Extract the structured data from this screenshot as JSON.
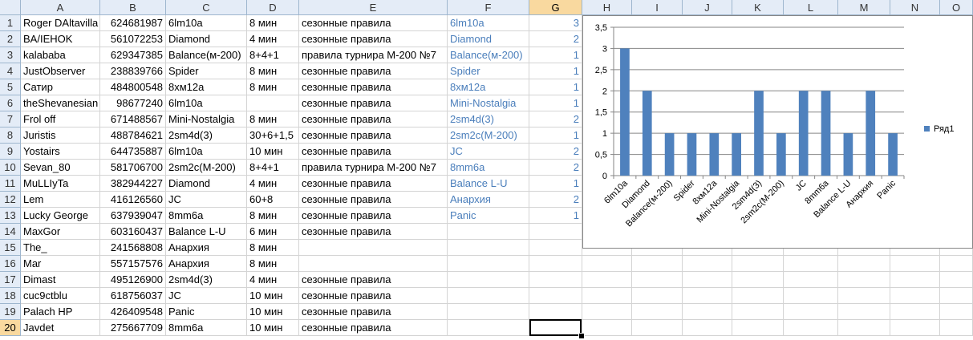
{
  "columns": [
    "A",
    "B",
    "C",
    "D",
    "E",
    "F",
    "G",
    "H",
    "I",
    "J",
    "K",
    "L",
    "M",
    "N",
    "O"
  ],
  "selected_column": "G",
  "selected_row": 20,
  "rows": [
    {
      "n": "1",
      "a": "Roger DAltavilla",
      "b": "624681987",
      "c": "6lm10a",
      "d": "8 мин",
      "e": "сезонные правила",
      "f": "6lm10a",
      "g": "3"
    },
    {
      "n": "2",
      "a": "BA/IEHOK",
      "b": "561072253",
      "c": "Diamond",
      "d": "4 мин",
      "e": "сезонные правила",
      "f": "Diamond",
      "g": "2"
    },
    {
      "n": "3",
      "a": "kalababa",
      "b": "629347385",
      "c": "Balance(м-200)",
      "d": "8+4+1",
      "e": "правила турнира М-200 №7",
      "f": "Balance(м-200)",
      "g": "1"
    },
    {
      "n": "4",
      "a": "JustObserver",
      "b": "238839766",
      "c": "Spider",
      "d": "8 мин",
      "e": "сезонные правила",
      "f": "Spider",
      "g": "1"
    },
    {
      "n": "5",
      "a": "Сатир",
      "b": "484800548",
      "c": "8хм12а",
      "d": "8 мин",
      "e": "сезонные правила",
      "f": "8хм12а",
      "g": "1"
    },
    {
      "n": "6",
      "a": "theShevanesian",
      "b": "98677240",
      "c": "6lm10a",
      "d": "",
      "e": "сезонные правила",
      "f": "Mini-Nostalgia",
      "g": "1"
    },
    {
      "n": "7",
      "a": "Frol off",
      "b": "671488567",
      "c": "Mini-Nostalgia",
      "d": "8 мин",
      "e": "сезонные правила",
      "f": "2sm4d(3)",
      "g": "2"
    },
    {
      "n": "8",
      "a": "Juristis",
      "b": "488784621",
      "c": "2sm4d(3)",
      "d": "30+6+1,5",
      "e": "сезонные правила",
      "f": "2sm2c(М-200)",
      "g": "1"
    },
    {
      "n": "9",
      "a": "Yostairs",
      "b": "644735887",
      "c": "6lm10a",
      "d": "10 мин",
      "e": "сезонные правила",
      "f": "JC",
      "g": "2"
    },
    {
      "n": "10",
      "a": "Sevan_80",
      "b": "581706700",
      "c": "2sm2c(М-200)",
      "d": "8+4+1",
      "e": "правила турнира М-200 №7",
      "f": "8mm6a",
      "g": "2"
    },
    {
      "n": "11",
      "a": "MuLLIyTa",
      "b": "382944227",
      "c": "Diamond",
      "d": "4 мин",
      "e": "сезонные правила",
      "f": "Balance L-U",
      "g": "1"
    },
    {
      "n": "12",
      "a": "Lem",
      "b": "416126560",
      "c": "JC",
      "d": "60+8",
      "e": "сезонные правила",
      "f": "Анархия",
      "g": "2"
    },
    {
      "n": "13",
      "a": "Lucky George",
      "b": "637939047",
      "c": "8mm6a",
      "d": "8 мин",
      "e": "сезонные правила",
      "f": "Panic",
      "g": "1"
    },
    {
      "n": "14",
      "a": "MaxGor",
      "b": "603160437",
      "c": "Balance L-U",
      "d": "6 мин",
      "e": "сезонные правила",
      "f": "",
      "g": ""
    },
    {
      "n": "15",
      "a": "The_",
      "b": "241568808",
      "c": "Анархия",
      "d": "8 мин",
      "e": "",
      "f": "",
      "g": ""
    },
    {
      "n": "16",
      "a": "Mar",
      "b": "557157576",
      "c": "Анархия",
      "d": "8 мин",
      "e": "",
      "f": "",
      "g": ""
    },
    {
      "n": "17",
      "a": "Dimast",
      "b": "495126900",
      "c": "2sm4d(3)",
      "d": "4 мин",
      "e": "сезонные правила",
      "f": "",
      "g": ""
    },
    {
      "n": "18",
      "a": "cuc9ctblu",
      "b": "618756037",
      "c": "JC",
      "d": "10 мин",
      "e": "сезонные правила",
      "f": "",
      "g": ""
    },
    {
      "n": "19",
      "a": "Palach HP",
      "b": "426409548",
      "c": "Panic",
      "d": "10 мин",
      "e": "сезонные правила",
      "f": "",
      "g": ""
    },
    {
      "n": "20",
      "a": "Javdet",
      "b": "275667709",
      "c": "8mm6a",
      "d": "10 мин",
      "e": "сезонные правила",
      "f": "",
      "g": ""
    }
  ],
  "chart_data": {
    "type": "bar",
    "categories": [
      "6lm10a",
      "Diamond",
      "Balance(м-200)",
      "Spider",
      "8хм12а",
      "Mini-Nostalgia",
      "2sm4d(3)",
      "2sm2c(М-200)",
      "JC",
      "8mm6a",
      "Balance L-U",
      "Анархия",
      "Panic"
    ],
    "series": [
      {
        "name": "Ряд1",
        "values": [
          3,
          2,
          1,
          1,
          1,
          1,
          2,
          1,
          2,
          2,
          1,
          2,
          1
        ],
        "color": "#4f81bd"
      }
    ],
    "ylim": [
      0,
      3.5
    ],
    "yticks": [
      "0",
      "0,5",
      "1",
      "1,5",
      "2",
      "2,5",
      "3",
      "3,5"
    ],
    "grid": true,
    "legend": "right"
  }
}
